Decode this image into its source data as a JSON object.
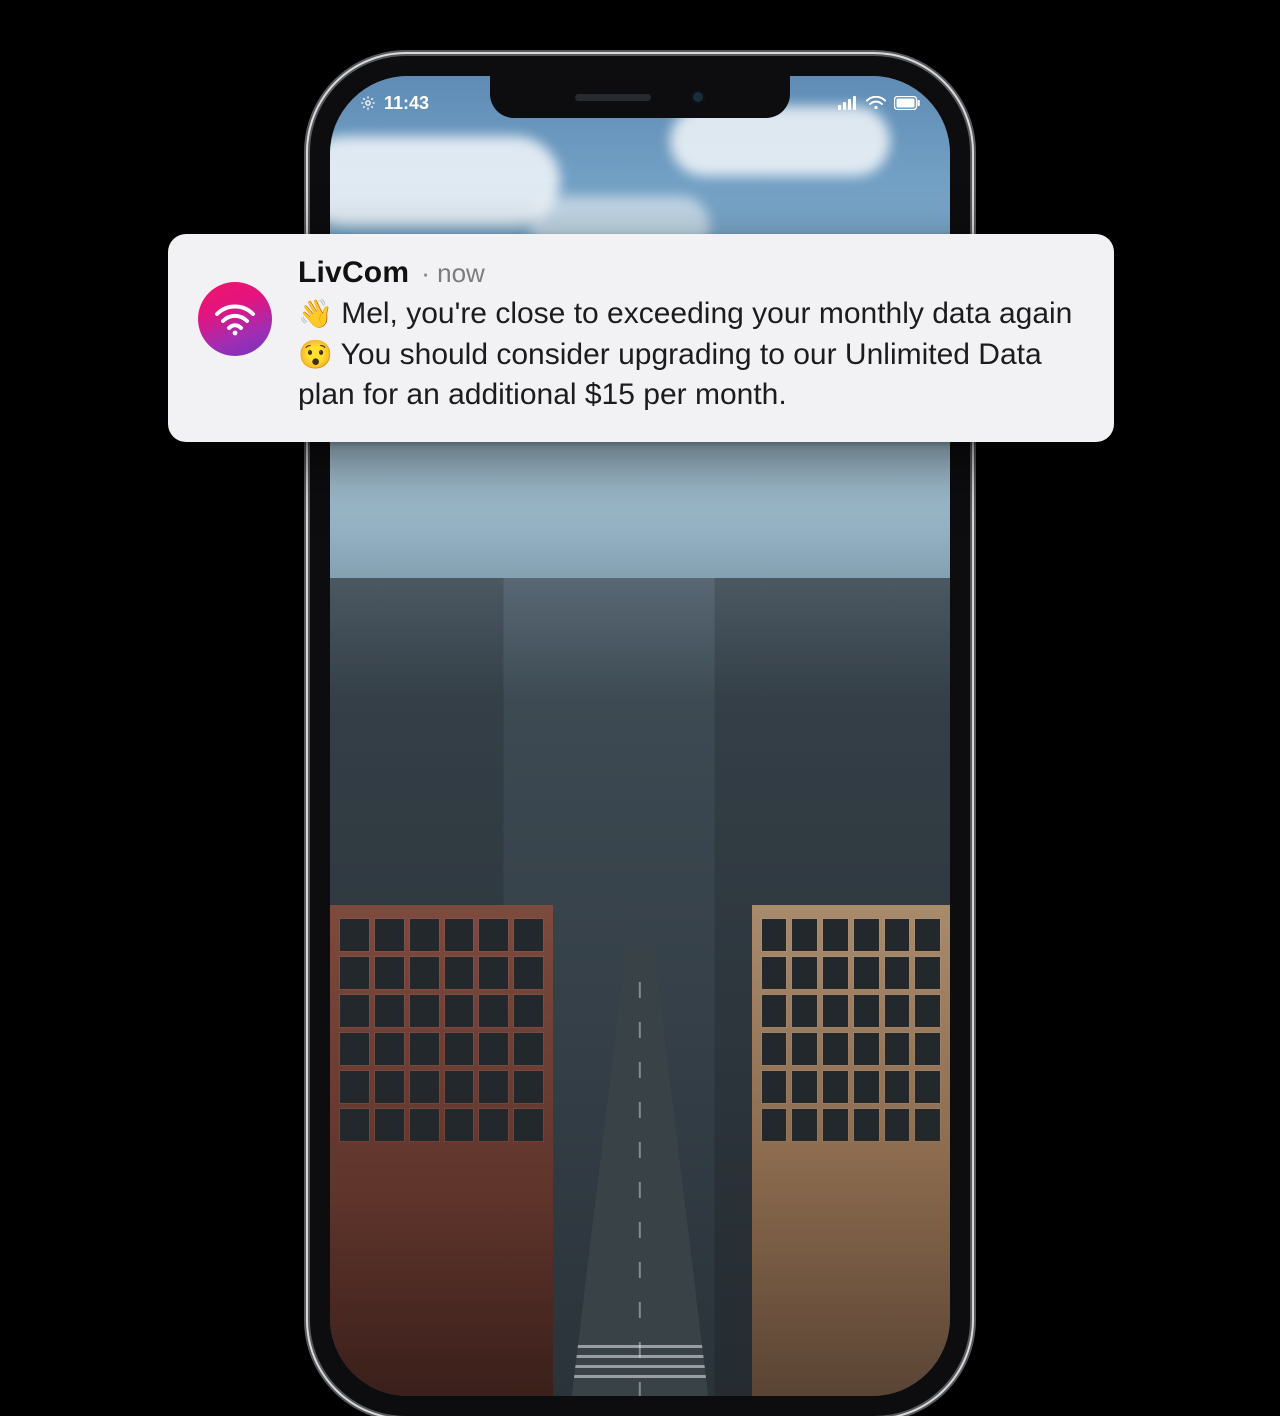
{
  "status": {
    "time": "11:43"
  },
  "notification": {
    "app_name": "LivCom",
    "time_sep": "·",
    "time_label": "now",
    "message_prefix": " Mel, you're close to exceeding your monthly data again ",
    "message_suffix": " You should consider upgrading to our Unlimited Data plan for an additional $15 per month.",
    "emoji_wave": "👋",
    "emoji_face": "😯"
  }
}
